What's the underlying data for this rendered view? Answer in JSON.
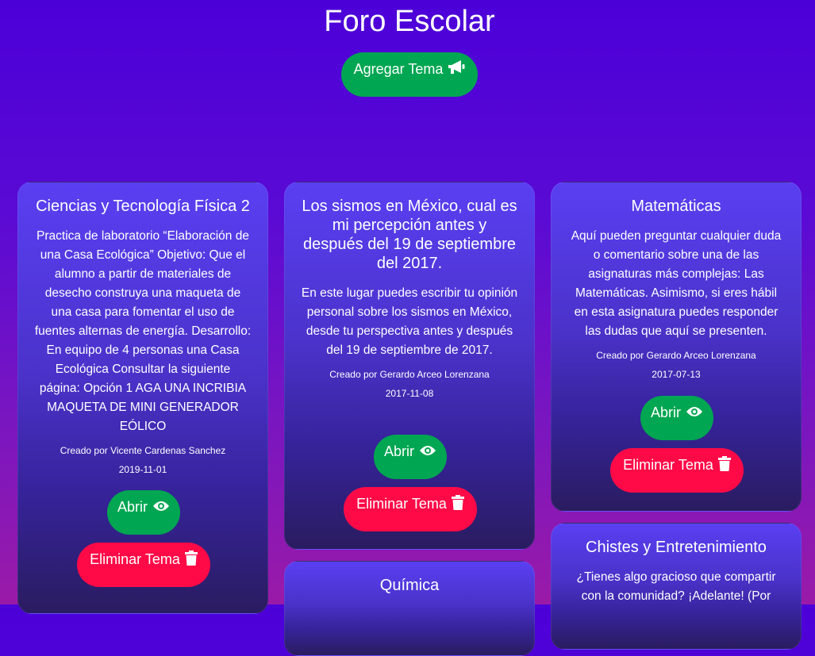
{
  "header": {
    "title": "Foro Escolar",
    "add_topic_label": "Agregar Tema"
  },
  "topics": [
    {
      "title": "Ciencias y Tecnología Física 2",
      "description": "Practica de laboratorio “Elaboración de una Casa Ecológica” Objetivo: Que el alumno a partir de materiales de desecho construya una maqueta de una casa para fomentar el uso de fuentes alternas de energía. Desarrollo: En equipo de 4 personas una Casa Ecológica Consultar la siguiente página: Opción 1 AGA UNA INCRIBIA MAQUETA DE MINI GENERADOR EÓLICO",
      "author": "Creado por Vicente Cardenas Sanchez",
      "date": "2019-11-01",
      "open_label": "Abrir",
      "delete_label": "Eliminar Tema"
    },
    {
      "title": "Los sismos en México, cual es mi percepción antes y después del 19 de septiembre del 2017.",
      "description": "En este lugar puedes escribir tu opinión personal sobre los sismos en México, desde tu perspectiva antes y después del 19 de septiembre de 2017.",
      "author": "Creado por Gerardo Arceo Lorenzana",
      "date": "2017-11-08",
      "open_label": "Abrir",
      "delete_label": "Eliminar Tema"
    },
    {
      "title": "Matemáticas",
      "description": "Aquí pueden preguntar cualquier duda o comentario sobre una de las asignaturas más complejas: Las Matemáticas. Asimismo, si eres hábil en esta asignatura puedes responder las dudas que aquí se presenten.",
      "author": "Creado por Gerardo Arceo Lorenzana",
      "date": "2017-07-13",
      "open_label": "Abrir",
      "delete_label": "Eliminar Tema"
    },
    {
      "title": "Química"
    },
    {
      "title": "Chistes y Entretenimiento",
      "description": "¿Tienes algo gracioso que compartir con la comunidad? ¡Adelante! (Por"
    }
  ],
  "icons": {
    "add": "megaphone-icon",
    "open": "eye-icon",
    "delete": "trash-icon"
  },
  "colors": {
    "open_button": "#00a651",
    "delete_button": "#ff0a47"
  }
}
